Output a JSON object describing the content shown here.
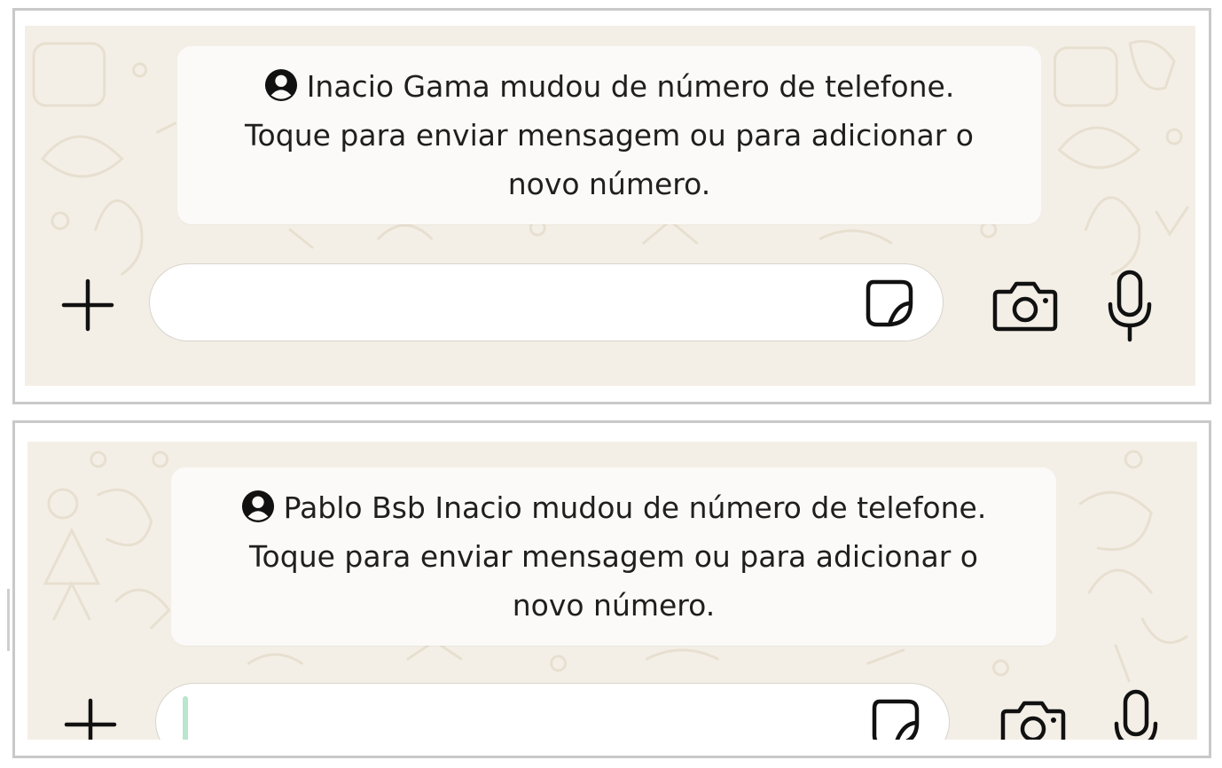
{
  "screenshots": [
    {
      "system_message": {
        "line1": "Inacio Gama mudou de número de telefone.",
        "line2": "Toque para enviar mensagem ou para adicionar o",
        "line3": "novo número.",
        "icon": "contact-icon"
      },
      "composer": {
        "input_value": "",
        "icons": [
          "plus-icon",
          "sticker-icon",
          "camera-icon",
          "microphone-icon"
        ]
      }
    },
    {
      "system_message": {
        "line1": "Pablo Bsb Inacio mudou de número de telefone.",
        "line2": "Toque para enviar mensagem ou para adicionar o",
        "line3": "novo número.",
        "icon": "contact-icon"
      },
      "composer": {
        "input_value": "",
        "icons": [
          "plus-icon",
          "sticker-icon",
          "camera-icon",
          "microphone-icon"
        ]
      }
    }
  ],
  "colors": {
    "chat_background": "#f4efe6",
    "bubble": "#fbfaf8",
    "text": "#1f1f1f",
    "icon": "#111111",
    "panel_border": "#c9c9c9",
    "caret": "#b8e6cf"
  }
}
